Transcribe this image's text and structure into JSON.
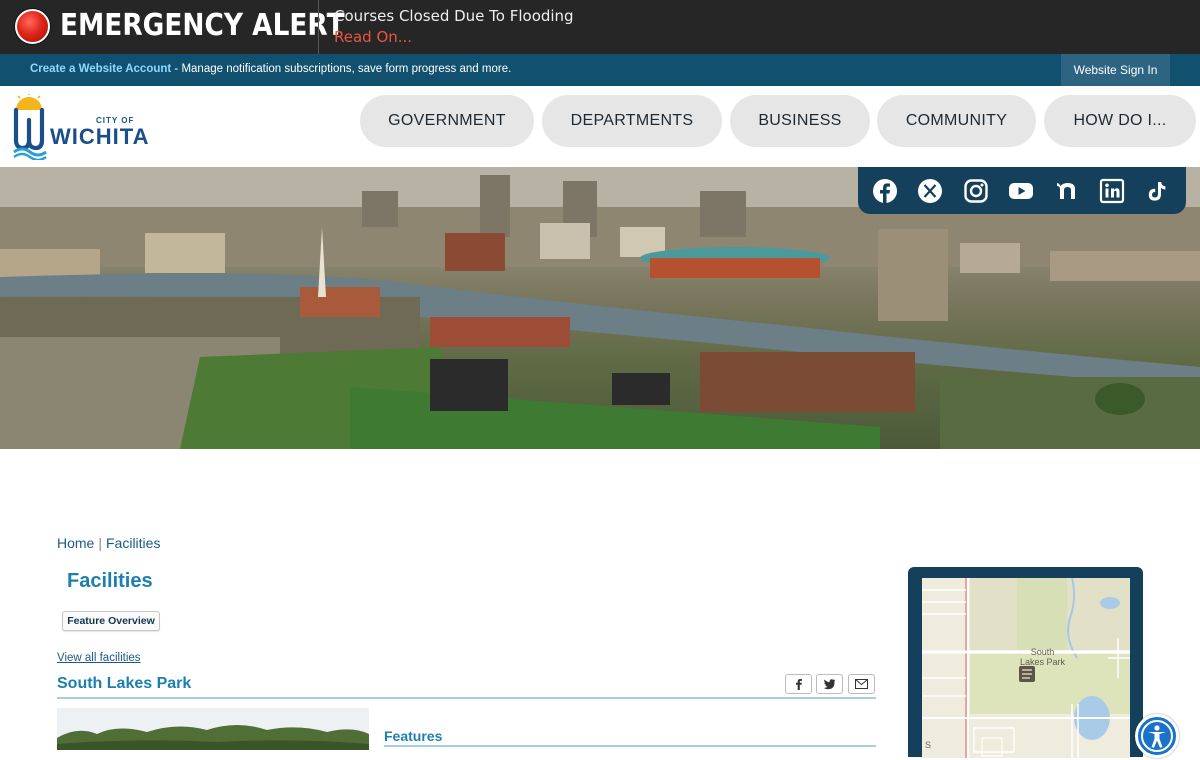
{
  "alert": {
    "title": "EMERGENCY ALERT",
    "message": "Courses Closed Due To Flooding",
    "link": "Read On..."
  },
  "account_bar": {
    "create_link": "Create a Website Account",
    "text": " - Manage notification subscriptions, save form progress and more.",
    "signin": "Website Sign In"
  },
  "logo": {
    "line1": "CITY OF",
    "line2": "WICHITA"
  },
  "nav": [
    "GOVERNMENT",
    "DEPARTMENTS",
    "BUSINESS",
    "COMMUNITY",
    "HOW DO I..."
  ],
  "social": [
    "facebook-icon",
    "x-icon",
    "instagram-icon",
    "youtube-icon",
    "nextdoor-icon",
    "linkedin-icon",
    "tiktok-icon"
  ],
  "breadcrumb": {
    "home": "Home",
    "separator": "|",
    "current": "Facilities"
  },
  "page": {
    "title": "Facilities",
    "feature_button": "Feature Overview",
    "view_all": "View all facilities",
    "park_name": "South Lakes Park",
    "features_heading": "Features"
  },
  "map": {
    "label_line1": "South",
    "label_line2": "Lakes Park",
    "street": "S"
  },
  "colors": {
    "alert_bg": "#262626",
    "account_bar": "#11506f",
    "accent": "#1d7fb0",
    "social_bar": "#15405c",
    "alert_red": "#e0261a"
  }
}
